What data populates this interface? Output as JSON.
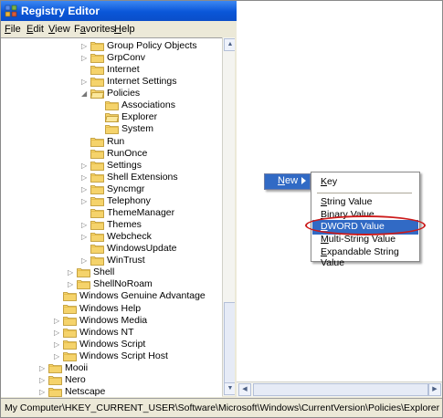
{
  "window": {
    "title": "Registry Editor",
    "app_icon": "regedit-icon"
  },
  "menu": [
    {
      "underline": "F",
      "rest": "ile"
    },
    {
      "underline": "E",
      "rest": "dit"
    },
    {
      "underline": "V",
      "rest": "iew"
    },
    {
      "pre": "F",
      "underline": "a",
      "rest": "vorites"
    },
    {
      "underline": "H",
      "rest": "elp"
    }
  ],
  "tree": [
    {
      "label": "Group Policy Objects",
      "exp": "▷"
    },
    {
      "label": "GrpConv",
      "exp": "▷"
    },
    {
      "label": "Internet",
      "exp": ""
    },
    {
      "label": "Internet Settings",
      "exp": "▷"
    },
    {
      "label": "Policies",
      "exp": "◢"
    },
    {
      "label": "Associations",
      "exp": ""
    },
    {
      "label": "Explorer",
      "exp": ""
    },
    {
      "label": "System",
      "exp": ""
    },
    {
      "label": "Run",
      "exp": ""
    },
    {
      "label": "RunOnce",
      "exp": ""
    },
    {
      "label": "Settings",
      "exp": "▷"
    },
    {
      "label": "Shell Extensions",
      "exp": "▷"
    },
    {
      "label": "Syncmgr",
      "exp": "▷"
    },
    {
      "label": "Telephony",
      "exp": "▷"
    },
    {
      "label": "ThemeManager",
      "exp": ""
    },
    {
      "label": "Themes",
      "exp": "▷"
    },
    {
      "label": "Webcheck",
      "exp": "▷"
    },
    {
      "label": "WindowsUpdate",
      "exp": ""
    },
    {
      "label": "WinTrust",
      "exp": "▷"
    },
    {
      "label": "Shell",
      "exp": "▷"
    },
    {
      "label": "ShellNoRoam",
      "exp": "▷"
    },
    {
      "label": "Windows Genuine Advantage",
      "exp": ""
    },
    {
      "label": "Windows Help",
      "exp": ""
    },
    {
      "label": "Windows Media",
      "exp": "▷"
    },
    {
      "label": "Windows NT",
      "exp": "▷"
    },
    {
      "label": "Windows Script",
      "exp": "▷"
    },
    {
      "label": "Windows Script Host",
      "exp": "▷"
    },
    {
      "label": "Mooii",
      "exp": "▷"
    },
    {
      "label": "Nero",
      "exp": "▷"
    },
    {
      "label": "Netscape",
      "exp": "▷"
    }
  ],
  "context_menu": {
    "new_label": "New",
    "new_underline": "N",
    "items": [
      {
        "label": "Key",
        "underline": "K",
        "highlighted": false
      },
      {
        "label": "String Value",
        "underline": "S",
        "highlighted": false
      },
      {
        "label": "Binary Value",
        "underline": "B",
        "highlighted": false
      },
      {
        "label": "DWORD Value",
        "underline": "D",
        "highlighted": true
      },
      {
        "label": "Multi-String Value",
        "underline": "M",
        "highlighted": false
      },
      {
        "label": "Expandable String Value",
        "underline": "E",
        "highlighted": false
      }
    ]
  },
  "status_bar": {
    "path": "My Computer\\HKEY_CURRENT_USER\\Software\\Microsoft\\Windows\\CurrentVersion\\Policies\\Explorer"
  },
  "colors": {
    "title_bar": "#0a56d8",
    "highlight": "#316ac5",
    "annotation_oval": "#cc1a1a",
    "folder": "#f5d36b"
  }
}
